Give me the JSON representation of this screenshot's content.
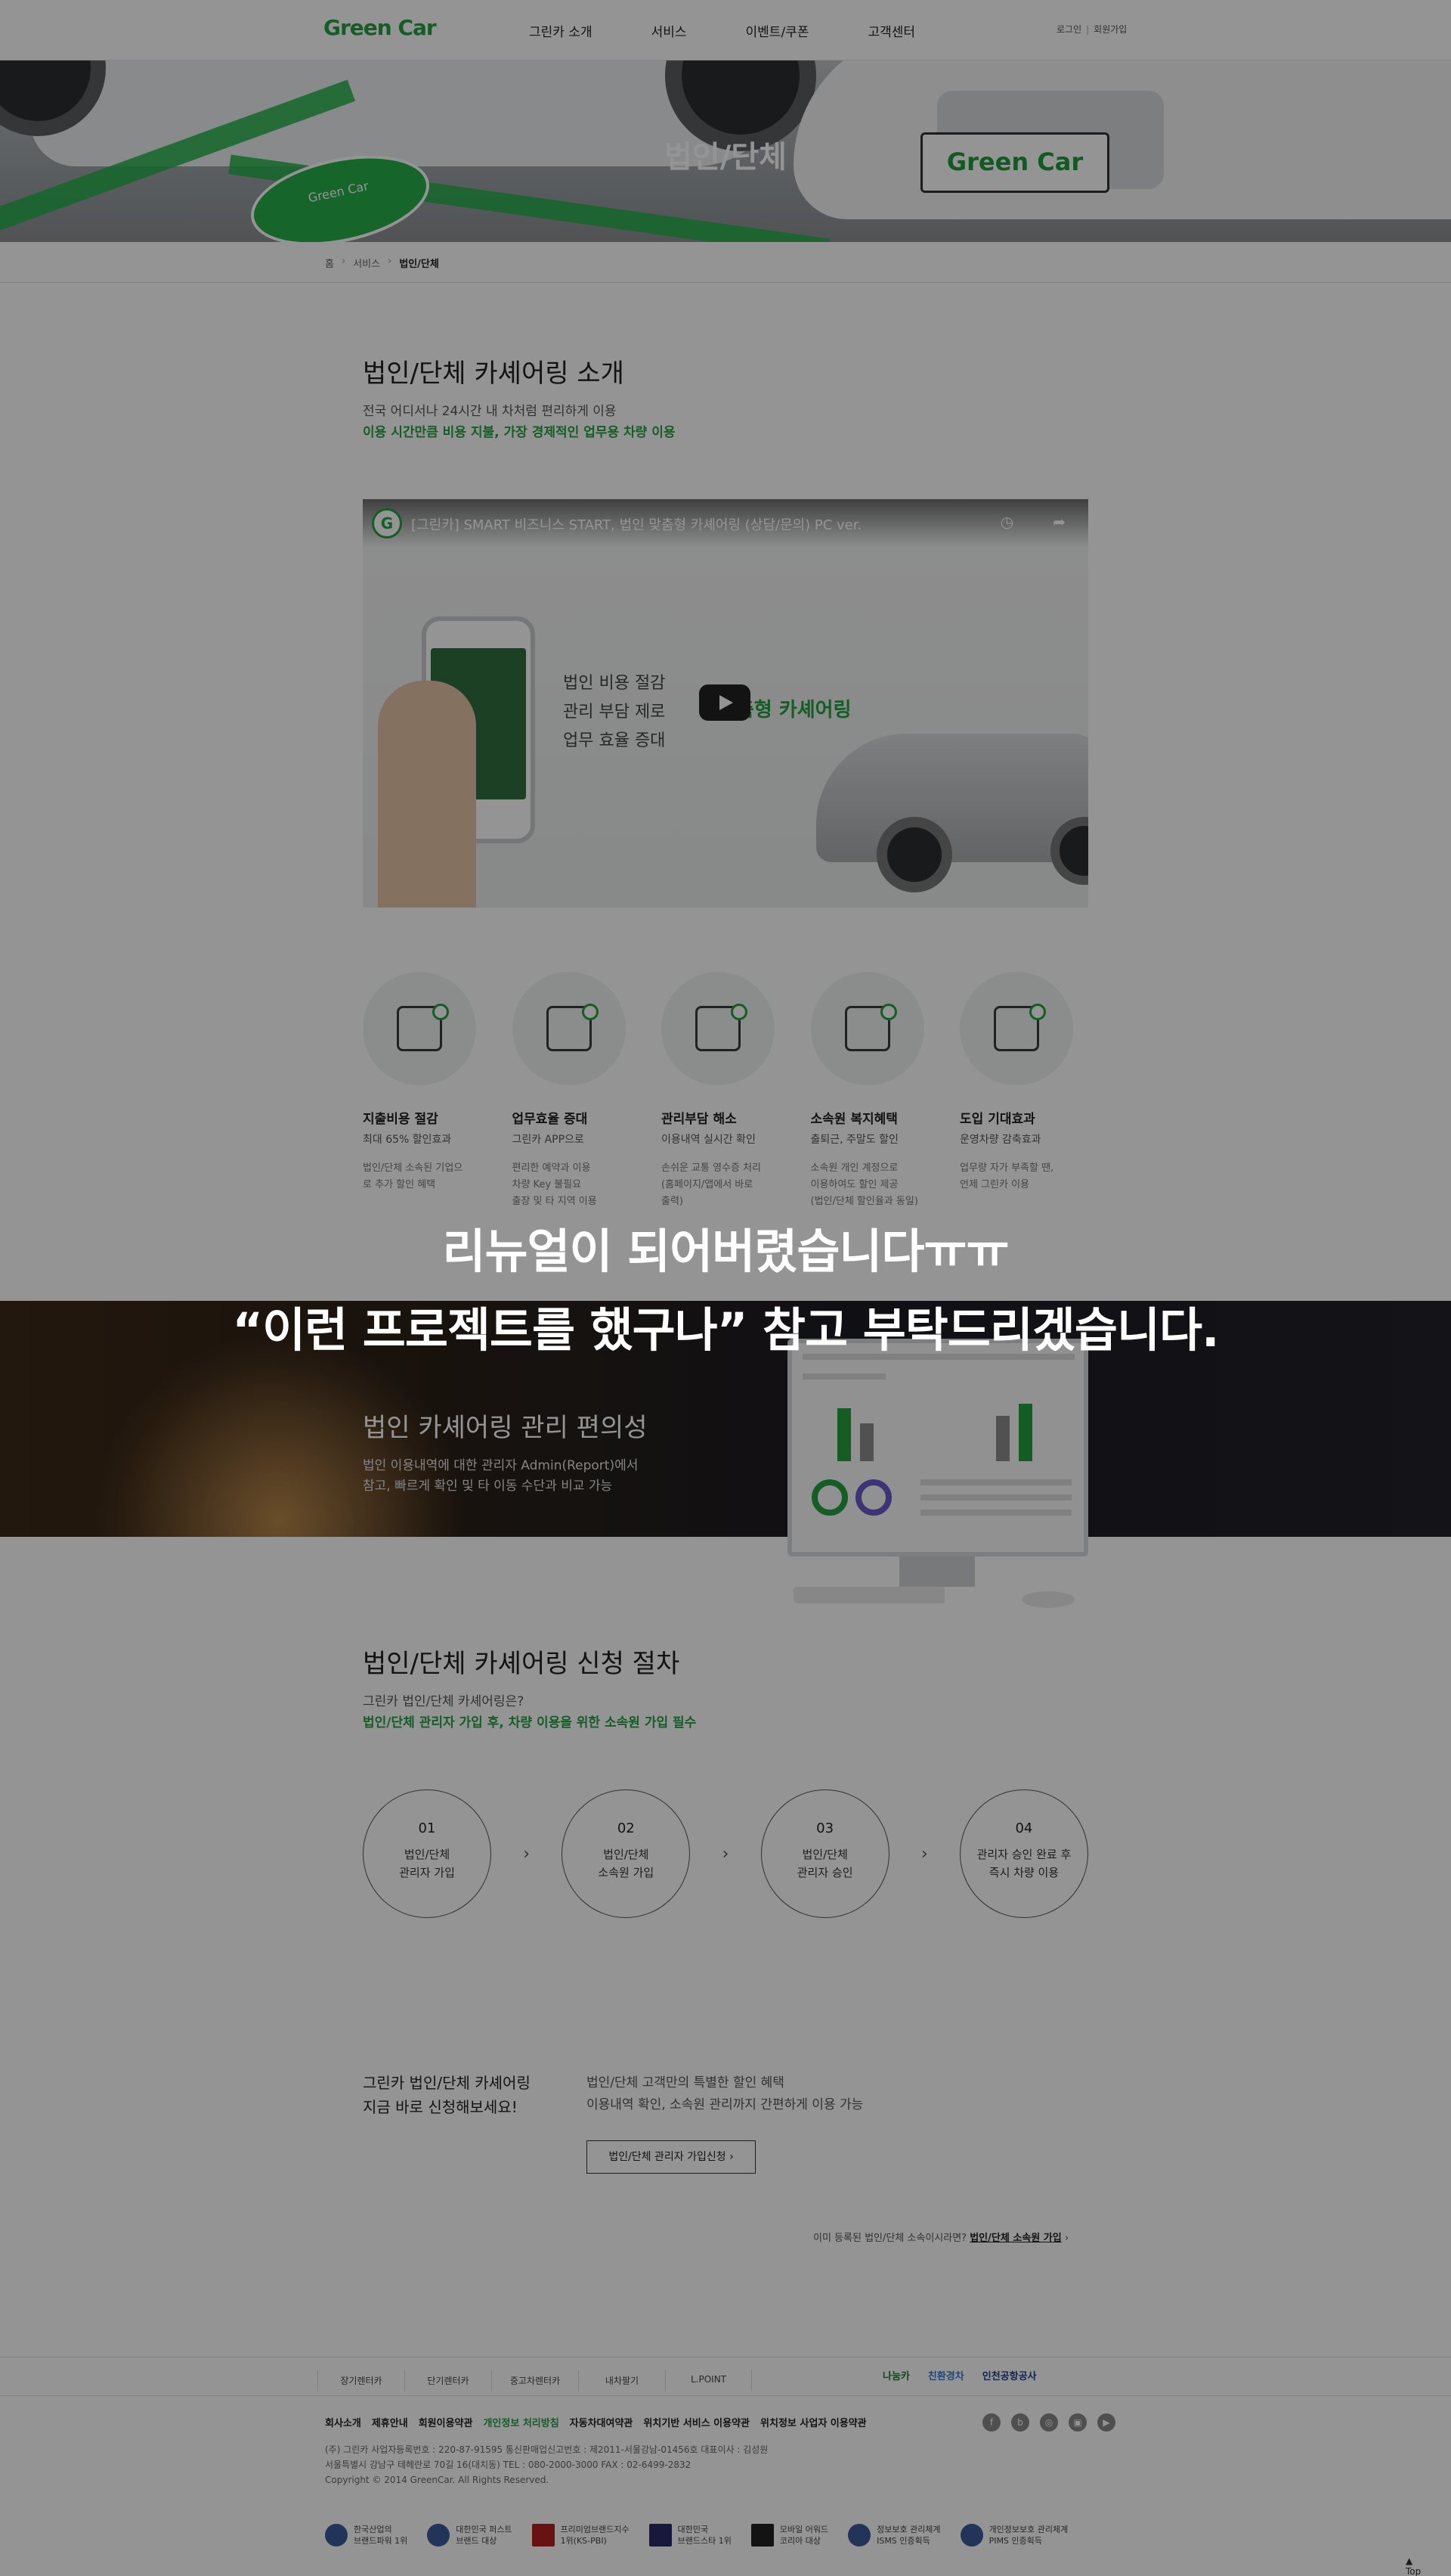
{
  "header": {
    "logo": "Green Car",
    "nav": [
      "그린카 소개",
      "서비스",
      "이벤트/쿠폰",
      "고객센터"
    ],
    "login": "로그인",
    "signup": "회원가입"
  },
  "hero": {
    "title": "법인/단체",
    "plate": "Green Car"
  },
  "breadcrumb": {
    "home": "홈",
    "service": "서비스",
    "current": "법인/단체"
  },
  "intro": {
    "title": "법인/단체 카셰어링 소개",
    "line1": "전국 어디서나 24시간 내 차처럼 편리하게 이용",
    "line2": "이용 시간만큼 비용 지불, 가장 경제적인 업무용 차량 이용"
  },
  "video": {
    "title": "[그린카] SMART 비즈니스 START, 법인 맞춤형 카셰어링 (상담/문의) PC ver.",
    "text_lines": [
      "법인 비용 절감",
      "관리 부담 제로",
      "업무 효율 증대"
    ],
    "text_right": "맞춤형 카셰어링"
  },
  "benefits": [
    {
      "title": "지출비용 절감",
      "sub": "최대 65% 할인효과",
      "desc": [
        "법인/단체 소속된 기업으",
        "로 추가 할인 혜택"
      ]
    },
    {
      "title": "업무효율 증대",
      "sub": "그린카 APP으로",
      "desc": [
        "편리한 예약과 이용",
        "차량 Key 불필요",
        "출장 및 타 지역 이용"
      ]
    },
    {
      "title": "관리부담 해소",
      "sub": "이용내역 실시간 확인",
      "desc": [
        "손쉬운 교통 영수증 처리",
        "(홈페이지/앱에서 바로",
        "출력)"
      ]
    },
    {
      "title": "소속원 복지혜택",
      "sub": "출퇴근, 주말도 할인",
      "desc": [
        "소속원 개인 계정으로",
        "이용하여도 할인 제공",
        "(법인/단체 할인율과 동일)"
      ]
    },
    {
      "title": "도입 기대효과",
      "sub": "운영차량 감축효과",
      "desc": [
        "업무량 자가 부족할 땐,",
        "언제 그린카 이용"
      ]
    }
  ],
  "overlay": {
    "line1": "리뉴얼이 되어버렸습니다ㅠㅠ",
    "line2": "“이런 프로젝트를 했구나” 참고 부탁드리겠습니다."
  },
  "admin": {
    "title": "법인 카셰어링 관리 편의성",
    "desc1": "법인 이용내역에 대한 관리자 Admin(Report)에서",
    "desc2": "참고, 빠르게 확인 및 타 이동 수단과 비교 가능"
  },
  "apply": {
    "title": "법인/단체 카셰어링 신청 절차",
    "line1": "그린카 법인/단체 카셰어링은?",
    "line2": "법인/단체 관리자 가입 후, 차량 이용을 위한 소속원 가입 필수",
    "steps": [
      {
        "num": "01",
        "l1": "법인/단체",
        "l2": "관리자 가입"
      },
      {
        "num": "02",
        "l1": "법인/단체",
        "l2": "소속원 가입"
      },
      {
        "num": "03",
        "l1": "법인/단체",
        "l2": "관리자 승인"
      },
      {
        "num": "04",
        "l1": "관리자 승인 완료 후",
        "l2": "즉시 차량 이용"
      }
    ]
  },
  "cta": {
    "left1": "그린카 법인/단체 카셰어링",
    "left2": "지금 바로 신청해보세요!",
    "right1": "법인/단체 고객만의 특별한 할인 혜택",
    "right2": "이용내역 확인, 소속원 관리까지 간편하게 이용 가능",
    "button": "법인/단체 관리자 가입신청",
    "member_q": "이미 등록된 법인/단체 소속이시라면?",
    "member_link": "법인/단체 소속원 가입"
  },
  "footer": {
    "links": [
      "장기렌터카",
      "단기렌터카",
      "중고차렌터카",
      "내차팔기",
      "L.POINT"
    ],
    "partners": [
      "나눔카",
      "친환경차",
      "인천공항공사"
    ],
    "policies": [
      "회사소개",
      "제휴안내",
      "회원이용약관",
      "개인정보 처리방침",
      "자동차대여약관",
      "위치기반 서비스 이용약관",
      "위치정보 사업자 이용약관"
    ],
    "info1": "(주) 그린카    사업자등록번호 : 220-87-91595    통신판매업신고번호 : 제2011-서울강남-01456호    대표이사 : 김성원",
    "info2": "서울특별시 강남구 테헤란로 70길 16(대치동)    TEL : 080-2000-3000    FAX : 02-6499-2832",
    "copyright": "Copyright © 2014 GreenCar. All Rights Reserved.",
    "awards": [
      {
        "l1": "한국산업의",
        "l2": "브랜드파워 1위"
      },
      {
        "l1": "대한민국 퍼스트",
        "l2": "브랜드 대상"
      },
      {
        "l1": "프리미엄브랜드지수",
        "l2": "1위(KS-PBI)"
      },
      {
        "l1": "대한민국",
        "l2": "브랜드스타 1위"
      },
      {
        "l1": "모바일 어워드",
        "l2": "코리아 대상"
      },
      {
        "l1": "정보보호 관리체계",
        "l2": "ISMS 인증획득"
      },
      {
        "l1": "개인정보보호 관리체계",
        "l2": "PIMS 인증획득"
      }
    ],
    "top": "Top"
  }
}
